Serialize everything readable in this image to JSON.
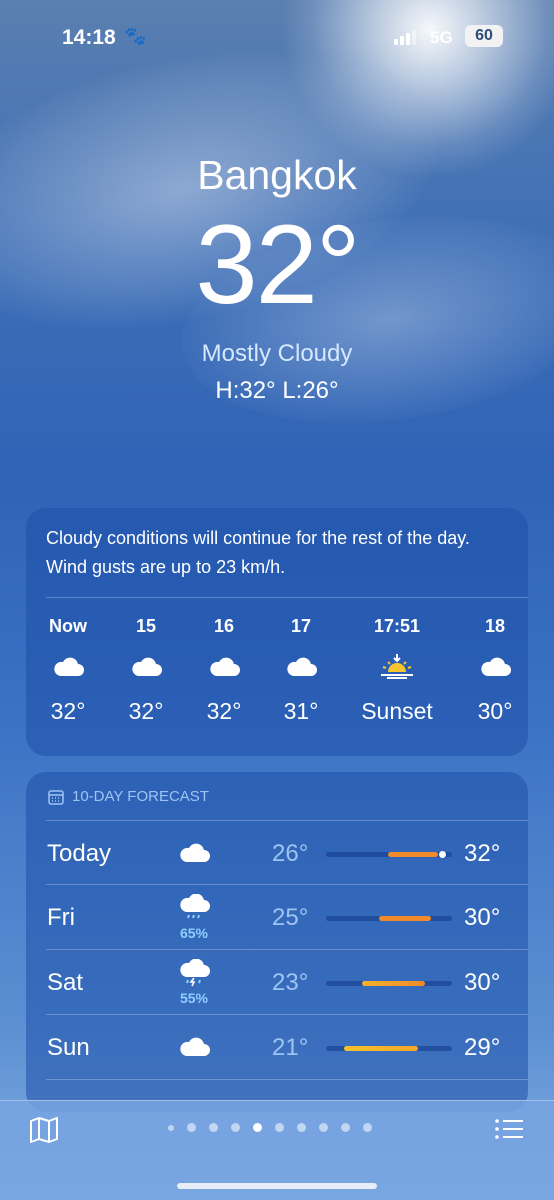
{
  "status": {
    "time": "14:18",
    "network": "5G",
    "battery": "60"
  },
  "location": {
    "city": "Bangkok",
    "temp": "32°",
    "condition": "Mostly Cloudy",
    "hilo": "H:32°  L:26°"
  },
  "hourly": {
    "summary": "Cloudy conditions will continue for the rest of the day. Wind gusts are up to 23 km/h.",
    "items": [
      {
        "label": "Now",
        "icon": "cloud-icon",
        "temp": "32°"
      },
      {
        "label": "15",
        "icon": "cloud-icon",
        "temp": "32°"
      },
      {
        "label": "16",
        "icon": "cloud-icon",
        "temp": "32°"
      },
      {
        "label": "17",
        "icon": "cloud-icon",
        "temp": "31°"
      },
      {
        "label": "17:51",
        "icon": "sunset-icon",
        "temp": "Sunset"
      },
      {
        "label": "18",
        "icon": "cloud-icon",
        "temp": "30°"
      }
    ]
  },
  "forecast": {
    "header": "10-DAY FORECAST",
    "days": [
      {
        "day": "Today",
        "icon": "cloud-icon",
        "precip": "",
        "low": "26°",
        "high": "32°"
      },
      {
        "day": "Fri",
        "icon": "cloud-rain-icon",
        "precip": "65%",
        "low": "25°",
        "high": "30°"
      },
      {
        "day": "Sat",
        "icon": "cloud-storm-icon",
        "precip": "55%",
        "low": "23°",
        "high": "30°"
      },
      {
        "day": "Sun",
        "icon": "cloud-icon",
        "precip": "",
        "low": "21°",
        "high": "29°"
      }
    ]
  },
  "colors": {
    "bar_orange": "#f0902a",
    "bar_yellow": "#f5b32a",
    "precip_blue": "#8ed0ff"
  },
  "page_indicator": {
    "count": 10,
    "active": 4
  }
}
